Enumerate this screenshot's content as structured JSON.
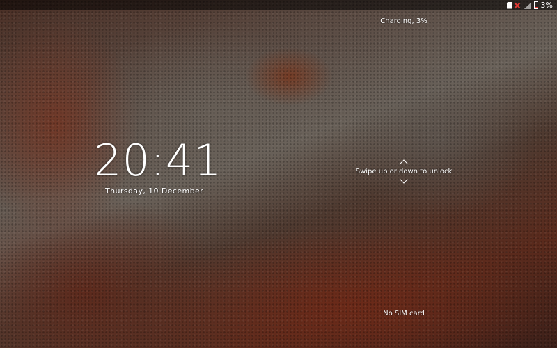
{
  "status_bar": {
    "battery_percent": "3%",
    "icons": [
      "sd-card-icon",
      "sim-alert-icon",
      "signal-icon",
      "battery-icon"
    ],
    "battery_color": "#e53935"
  },
  "lockscreen": {
    "charging_text": "Charging, 3%",
    "time": "20:41",
    "date": "Thursday, 10 December",
    "unlock_hint": "Swipe up or down to unlock",
    "sim_status": "No SIM card"
  },
  "colors": {
    "text": "#ffffff",
    "alert": "#e53935"
  }
}
